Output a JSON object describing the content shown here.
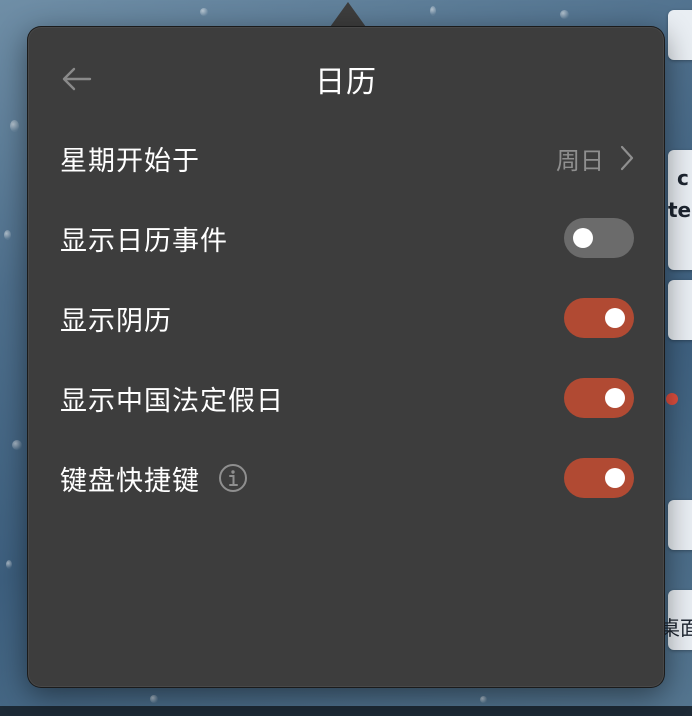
{
  "popover": {
    "title": "日历",
    "back_icon": "arrow-left-icon"
  },
  "settings": {
    "week_start": {
      "label": "星期开始于",
      "value": "周日",
      "icon": "chevron-right-icon"
    },
    "show_events": {
      "label": "显示日历事件",
      "enabled": false
    },
    "show_lunar": {
      "label": "显示阴历",
      "enabled": true
    },
    "show_holidays": {
      "label": "显示中国法定假日",
      "enabled": true
    },
    "shortcuts": {
      "label": "键盘快捷键",
      "enabled": true,
      "icon": "info-icon"
    }
  },
  "colors": {
    "toggle_on": "#b14a33",
    "toggle_off": "#6b6b6b",
    "popover_bg": "#3d3d3d",
    "status_dot": "#e04f3f"
  },
  "background": {
    "fragments": [
      "c",
      "te",
      "桌面"
    ]
  }
}
